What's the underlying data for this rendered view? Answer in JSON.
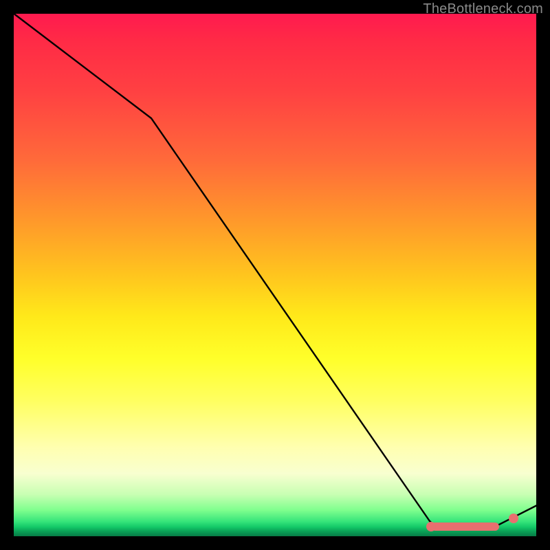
{
  "watermark": "TheBottleneck.com",
  "colors": {
    "background_frame": "#000000",
    "curve_stroke": "#000000",
    "marker": "#e86f6f"
  },
  "chart_data": {
    "type": "line",
    "title": "",
    "xlabel": "",
    "ylabel": "",
    "xlim": [
      0,
      100
    ],
    "ylim": [
      0,
      100
    ],
    "grid": false,
    "legend": false,
    "curve": [
      {
        "x": 0,
        "y": 100
      },
      {
        "x": 26,
        "y": 80
      },
      {
        "x": 80,
        "y": 3
      },
      {
        "x": 81,
        "y": 2
      },
      {
        "x": 88,
        "y": 2
      },
      {
        "x": 92,
        "y": 2
      },
      {
        "x": 100,
        "y": 6
      }
    ],
    "flat_segment": {
      "x_start": 80,
      "x_end": 92,
      "y": 2
    },
    "end_marker": {
      "x": 92,
      "y": 3
    }
  }
}
